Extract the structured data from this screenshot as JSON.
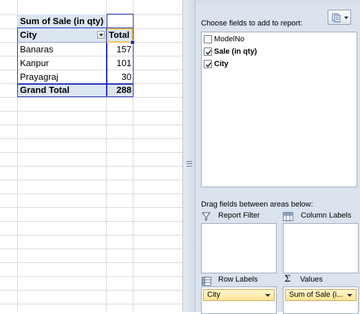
{
  "pivot": {
    "title": "Sum of Sale (in qty)",
    "row_header": "City",
    "value_header": "Total",
    "rows": [
      {
        "label": "Banaras",
        "value": "157"
      },
      {
        "label": "Kanpur",
        "value": "101"
      },
      {
        "label": "Prayagraj",
        "value": "30"
      }
    ],
    "grand_total_label": "Grand Total",
    "grand_total_value": "288"
  },
  "field_list": {
    "choose_label": "Choose fields to add to report:",
    "fields": [
      {
        "label": "ModelNo",
        "checked": false,
        "bold": false
      },
      {
        "label": "Sale (in qty)",
        "checked": true,
        "bold": true
      },
      {
        "label": "City",
        "checked": true,
        "bold": true
      }
    ],
    "drag_label": "Drag fields between areas below:",
    "areas": {
      "report_filter": "Report Filter",
      "column_labels": "Column Labels",
      "row_labels": "Row Labels",
      "values": "Values"
    },
    "row_chip": "City",
    "value_chip": "Sum of Sale (i..."
  },
  "colors": {
    "pivot_band": "#dce6f1",
    "selection_border": "#1f2fb8",
    "chip_fill": "#ffe598"
  }
}
